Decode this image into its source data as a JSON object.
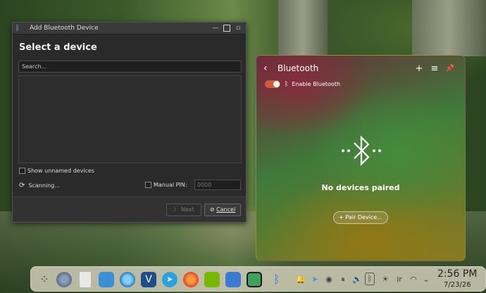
{
  "dialog": {
    "title": "Add Bluetooth Device",
    "heading": "Select a device",
    "search_placeholder": "Search...",
    "show_unnamed_label": "Show unnamed devices",
    "scanning_label": "Scanning...",
    "manual_pin_label": "Manual PIN:",
    "pin_placeholder": "0000",
    "next_label": "Next",
    "cancel_label": "Cancel"
  },
  "bluetooth_popup": {
    "title": "Bluetooth",
    "enable_label": "Enable Bluetooth",
    "enabled": true,
    "empty_message": "No devices paired",
    "pair_button_label": "Pair Device..."
  },
  "taskbar": {
    "apps": [
      "app-launcher",
      "settings",
      "files",
      "dolphin",
      "browser-circle",
      "vivaldi",
      "telegram",
      "firefox",
      "nvidia",
      "virtualbox",
      "spreadsheet",
      "bluetooth"
    ],
    "tray_text": "ir",
    "clock_time": "2:56 PM",
    "clock_date": "7/23/26"
  },
  "colors": {
    "toggle_on": "#d05a3a",
    "accent": "#6fb2ff"
  }
}
